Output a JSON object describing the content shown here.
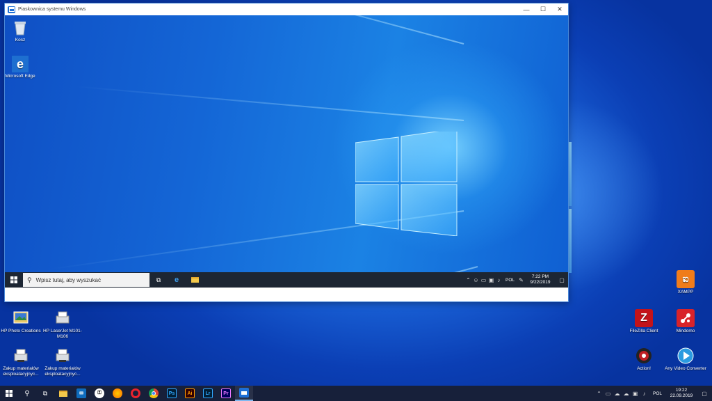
{
  "sandbox": {
    "title": "Piaskownica systemu Windows",
    "icons": [
      {
        "label": "Kosz",
        "icon": "recycle-bin-icon"
      },
      {
        "label": "Microsoft Edge",
        "icon": "edge-icon"
      }
    ],
    "taskbar": {
      "search_placeholder": "Wpisz tutaj, aby wyszukać",
      "language": "POL",
      "time": "7:22 PM",
      "date": "9/22/2019"
    }
  },
  "desktop_icons_left": [
    {
      "label": "HP Photo Creations",
      "icon": "hp-photo-creations-icon"
    },
    {
      "label": "HP LaserJet M101-M106",
      "icon": "printer-icon"
    },
    {
      "label": "Zakup materiałów eksploatacyjnyc...",
      "icon": "printer-icon"
    },
    {
      "label": "Zakup materiałów eksploatacyjnyc...",
      "icon": "printer-icon"
    }
  ],
  "desktop_icons_right": [
    {
      "label": "XAMPP",
      "icon": "xampp-icon",
      "color": "#f07c1a"
    },
    {
      "label": "FileZilla Client",
      "icon": "filezilla-icon",
      "color": "#c3131a"
    },
    {
      "label": "Mindomo",
      "icon": "mindomo-icon",
      "color": "#d8232a"
    },
    {
      "label": "Action!",
      "icon": "action-icon",
      "color": "#c01e24"
    },
    {
      "label": "Any Video Converter",
      "icon": "any-video-converter-icon",
      "color": "#2b9be0"
    }
  ],
  "host_taskbar": {
    "apps": [
      {
        "name": "Ps",
        "color": "#31a8ff",
        "bg": "#001e36"
      },
      {
        "name": "Ai",
        "color": "#ff9a00",
        "bg": "#330000"
      },
      {
        "name": "Lr",
        "color": "#31a8ff",
        "bg": "#001e36"
      },
      {
        "name": "Pr",
        "color": "#ea77ff",
        "bg": "#00005b"
      }
    ],
    "language": "POL",
    "time": "19:22",
    "date": "22.09.2019"
  }
}
